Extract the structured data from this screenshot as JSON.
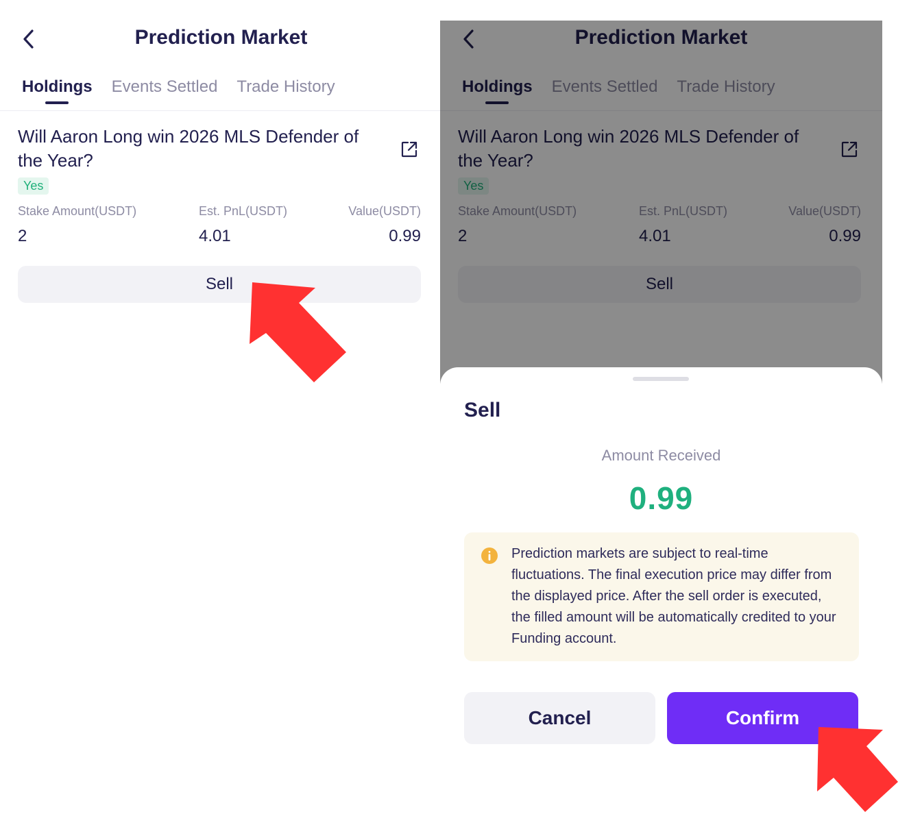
{
  "colors": {
    "accent": "#6f2df6",
    "positive": "#1fb07e",
    "arrow": "#ff3131",
    "notice_bg": "#fbf7ea",
    "info": "#f3b33d"
  },
  "left": {
    "header": {
      "back_icon": "chevron-left-icon",
      "title": "Prediction Market"
    },
    "tabs": [
      {
        "label": "Holdings",
        "active": true
      },
      {
        "label": "Events Settled"
      },
      {
        "label": "Trade History"
      }
    ],
    "position": {
      "question": "Will Aaron Long win 2026 MLS Defender of the Year?",
      "share_icon": "external-link-icon",
      "outcome": "Yes",
      "stake_label": "Stake Amount(USDT)",
      "stake_value": "2",
      "pnl_label": "Est. PnL(USDT)",
      "pnl_value": "4.01",
      "value_label": "Value(USDT)",
      "value_value": "0.99",
      "sell_label": "Sell"
    }
  },
  "right": {
    "header": {
      "back_icon": "chevron-left-icon",
      "title": "Prediction Market"
    },
    "tabs": [
      {
        "label": "Holdings",
        "active": true
      },
      {
        "label": "Events Settled"
      },
      {
        "label": "Trade History"
      }
    ],
    "position": {
      "question": "Will Aaron Long win 2026 MLS Defender of the Year?",
      "outcome": "Yes",
      "stake_label": "Stake Amount(USDT)",
      "stake_value": "2",
      "pnl_label": "Est. PnL(USDT)",
      "pnl_value": "4.01",
      "value_label": "Value(USDT)",
      "value_value": "0.99",
      "sell_label": "Sell"
    },
    "sheet": {
      "title": "Sell",
      "amount_label": "Amount Received",
      "amount_value": "0.99",
      "notice_icon": "info-icon",
      "notice": "Prediction markets are subject to real-time fluctuations. The final execution price may differ from the displayed price. After the sell order is executed, the filled amount will be automatically credited to your Funding account.",
      "cancel_label": "Cancel",
      "confirm_label": "Confirm"
    }
  }
}
